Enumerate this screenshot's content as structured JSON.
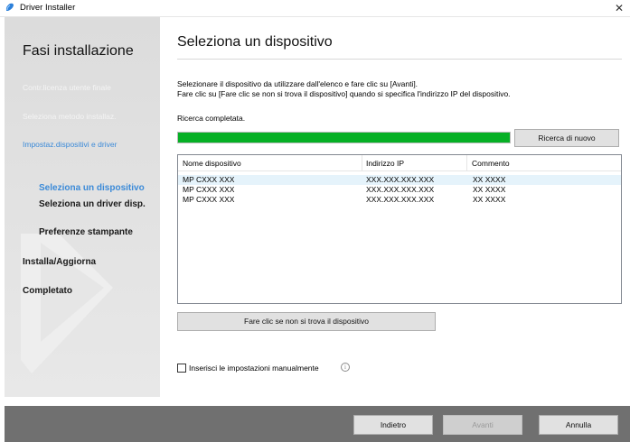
{
  "window": {
    "title": "Driver Installer",
    "close_glyph": "✕"
  },
  "sidebar": {
    "title": "Fasi installazione",
    "steps": [
      {
        "label": "Contr.licenza utente finale"
      },
      {
        "label": "Seleziona metodo installaz."
      },
      {
        "label": "Impostaz.dispositivi e driver"
      },
      {
        "label": "Seleziona un dispositivo"
      },
      {
        "label": "Seleziona un driver disp."
      },
      {
        "label": "Preferenze stampante"
      },
      {
        "label": "Installa/Aggiorna"
      },
      {
        "label": "Completato"
      }
    ]
  },
  "main": {
    "title": "Seleziona un dispositivo",
    "instructions": [
      "Selezionare il dispositivo da utilizzare dall'elenco e fare clic su [Avanti].",
      "Fare clic su [Fare clic se non si trova il dispositivo] quando si specifica l'indirizzo IP del dispositivo."
    ],
    "status": "Ricerca completata.",
    "progress_percent": 100,
    "search_again_label": "Ricerca di nuovo",
    "list": {
      "columns": [
        "Nome dispositivo",
        "Indirizzo IP",
        "Commento"
      ],
      "rows": [
        [
          "MP CXXX XXX",
          "XXX.XXX.XXX.XXX",
          "XX XXXX"
        ],
        [
          "MP CXXX XXX",
          "XXX.XXX.XXX.XXX",
          "XX XXXX"
        ],
        [
          "MP CXXX XXX",
          "XXX.XXX.XXX.XXX",
          "XX XXXX"
        ]
      ]
    },
    "not_found_label": "Fare clic se non si trova il dispositivo",
    "manual_checkbox_label": "Inserisci le impostazioni manualmente",
    "info_glyph": "i"
  },
  "footer": {
    "back_label": "Indietro",
    "next_label": "Avanti",
    "cancel_label": "Annulla"
  },
  "colors": {
    "progress": "#06b025",
    "accent": "#3b8ad8",
    "footer": "#707070"
  }
}
